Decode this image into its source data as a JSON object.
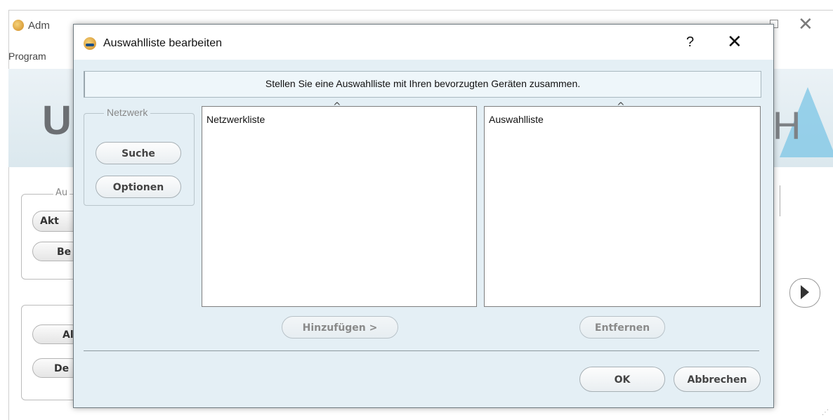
{
  "background_window": {
    "title": "Adm",
    "menu": "Program",
    "logo_left": "U",
    "logo_right": "H",
    "group1_label": "Au",
    "buttons": [
      "Akt",
      "Be",
      "Al",
      "De"
    ]
  },
  "dialog": {
    "title": "Auswahlliste bearbeiten",
    "help_label": "?",
    "close_label": "✕",
    "info_text": "Stellen Sie eine Auswahlliste mit Ihren bevorzugten Geräten zusammen.",
    "network_group": {
      "label": "Netzwerk",
      "search_button": "Suche",
      "options_button": "Optionen"
    },
    "network_list": {
      "header": "Netzwerkliste",
      "sort_caret": "^"
    },
    "selection_list": {
      "header": "Auswahlliste",
      "sort_caret": "^"
    },
    "add_button": "Hinzufügen >",
    "remove_button": "Entfernen",
    "ok_button": "OK",
    "cancel_button": "Abbrechen"
  },
  "colors": {
    "dialog_bg": "#e4eff5",
    "info_bg": "#eef6fa",
    "border": "#7f7f7f"
  }
}
